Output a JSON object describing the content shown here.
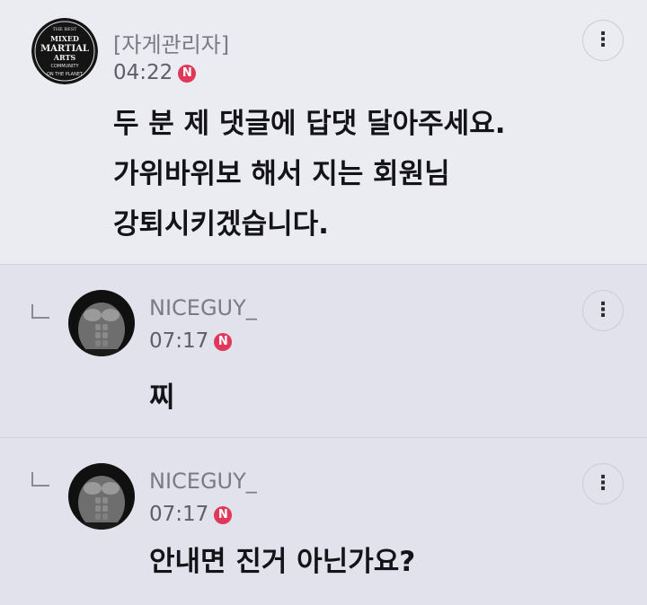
{
  "comments": [
    {
      "author": "[자게관리자]",
      "time": "04:22",
      "badge": "N",
      "avatar_icon": "mma-logo",
      "avatar_text": [
        "THE BEST",
        "MIXED",
        "MARTIAL",
        "ARTS",
        "COMMUNITY",
        "ON THE PLANET"
      ],
      "lines": [
        "두 분 제 댓글에 답댓 달아주세요.",
        "가위바위보 해서 지는 회원님",
        "강퇴시키겠습니다."
      ]
    },
    {
      "author": "NICEGUY_",
      "time": "07:17",
      "badge": "N",
      "avatar_icon": "muscle-torso-photo",
      "text": "찌"
    },
    {
      "author": "NICEGUY_",
      "time": "07:17",
      "badge": "N",
      "avatar_icon": "muscle-torso-photo",
      "text": "안내면 진거 아닌가요?"
    }
  ],
  "colors": {
    "badge": "#e0385a",
    "main_bg": "#ebebf2",
    "reply_bg": "#e1e2ec"
  },
  "icons": {
    "more": "⋮"
  }
}
